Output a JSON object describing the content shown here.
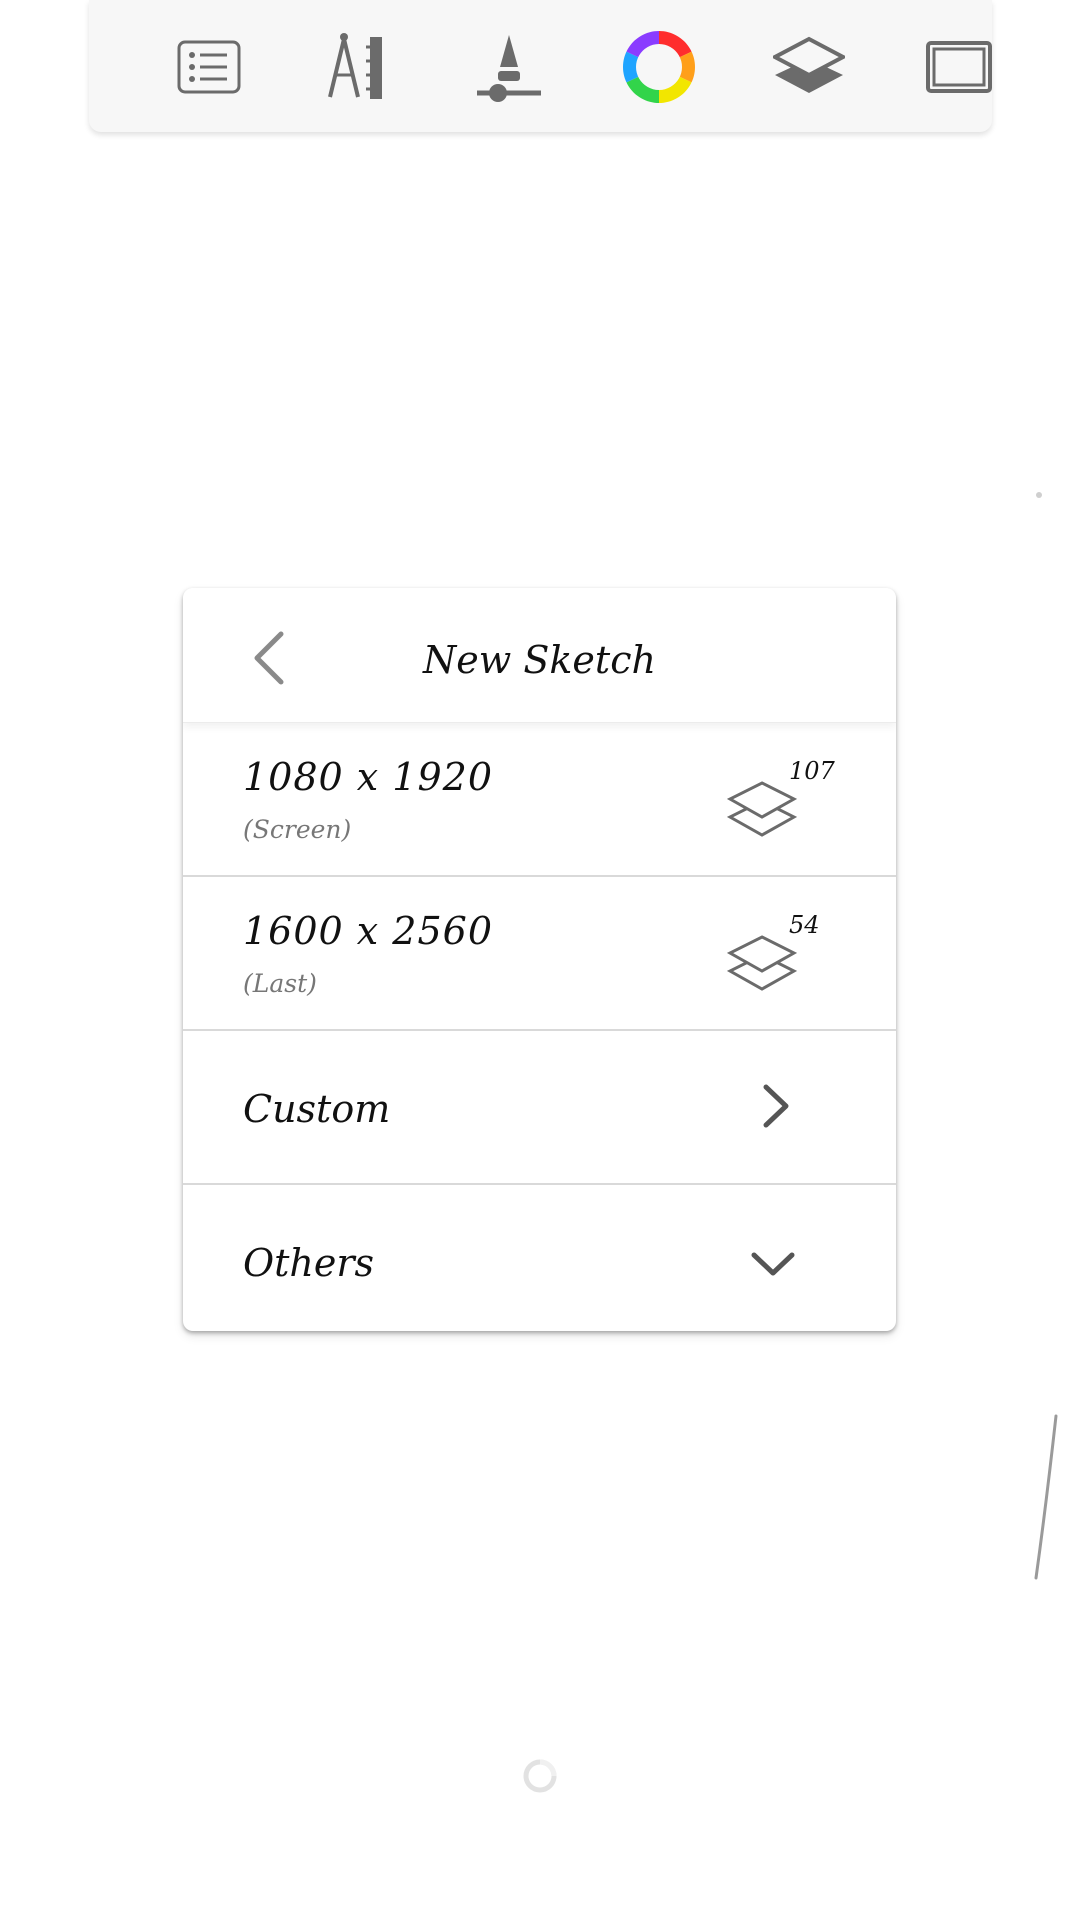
{
  "toolbar": {
    "tools": [
      {
        "icon": "list-icon"
      },
      {
        "icon": "compass-ruler-icon"
      },
      {
        "icon": "brush-size-icon"
      },
      {
        "icon": "color-wheel-icon"
      },
      {
        "icon": "layers-icon"
      },
      {
        "icon": "canvas-frame-icon"
      }
    ]
  },
  "dialog": {
    "title": "New Sketch",
    "back_icon": "chevron-left-icon",
    "sizes": [
      {
        "size": "1080 x 1920",
        "label": "(Screen)",
        "layers": "107"
      },
      {
        "size": "1600 x 2560",
        "label": "(Last)",
        "layers": "54"
      }
    ],
    "custom_label": "Custom",
    "others_label": "Others"
  },
  "colors": {
    "icon_gray": "#6b6b6b",
    "toolbar_bg": "#f7f7f7",
    "divider": "#d9d9d9"
  }
}
